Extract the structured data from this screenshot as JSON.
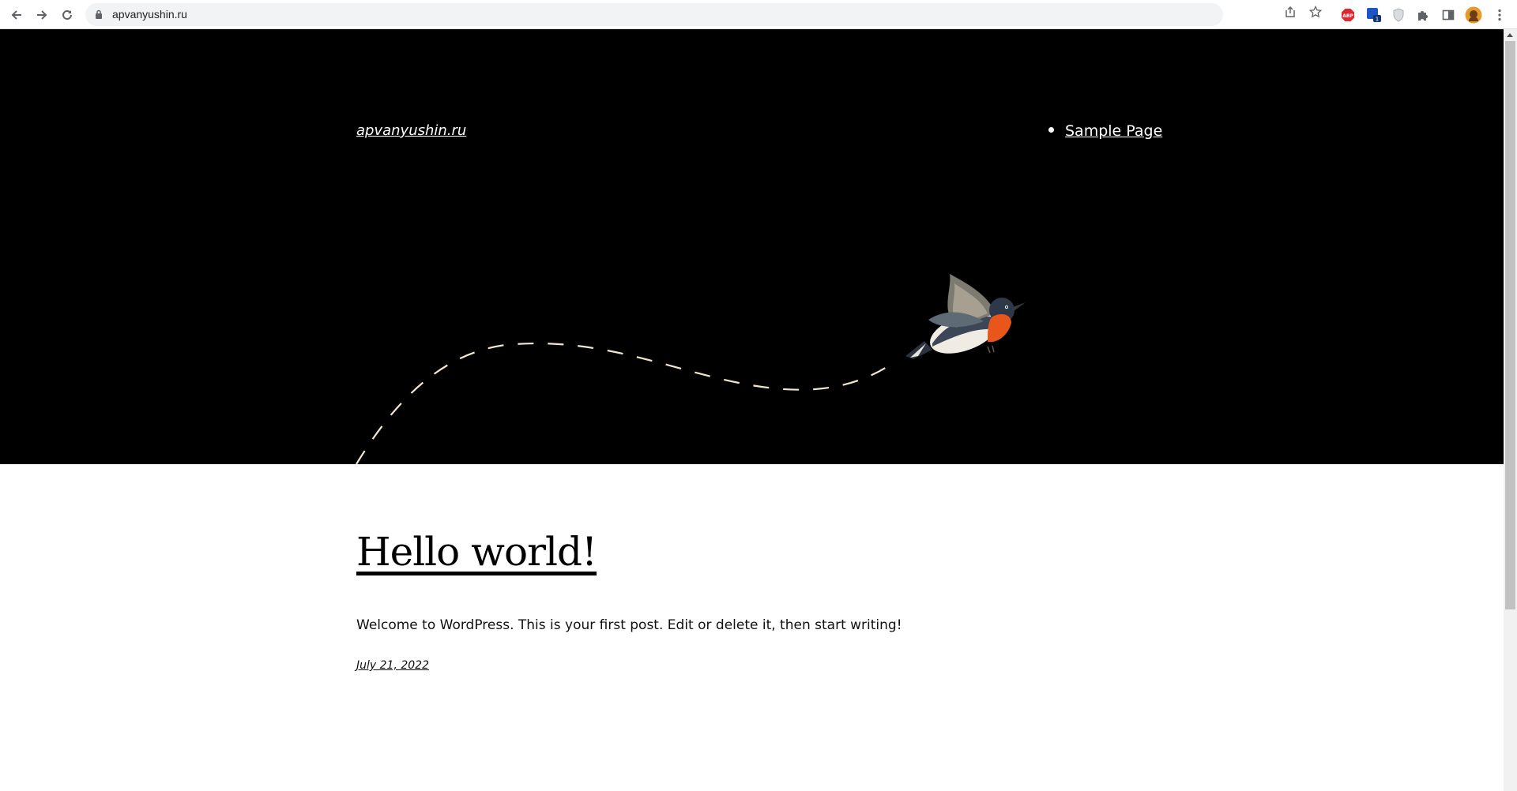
{
  "browser": {
    "url": "apvanyushin.ru",
    "extension_badges": {
      "abp": "ABP",
      "tab_counter": "1"
    }
  },
  "site": {
    "title": "apvanyushin.ru",
    "nav": [
      {
        "label": "Sample Page"
      }
    ]
  },
  "post": {
    "title": "Hello world!",
    "body": "Welcome to WordPress. This is your first post. Edit or delete it, then start writing!",
    "date": "July 21, 2022"
  },
  "colors": {
    "hero_background": "#000000",
    "dashed_path": "#f3e6cf",
    "bird_breast": "#e8561c"
  }
}
